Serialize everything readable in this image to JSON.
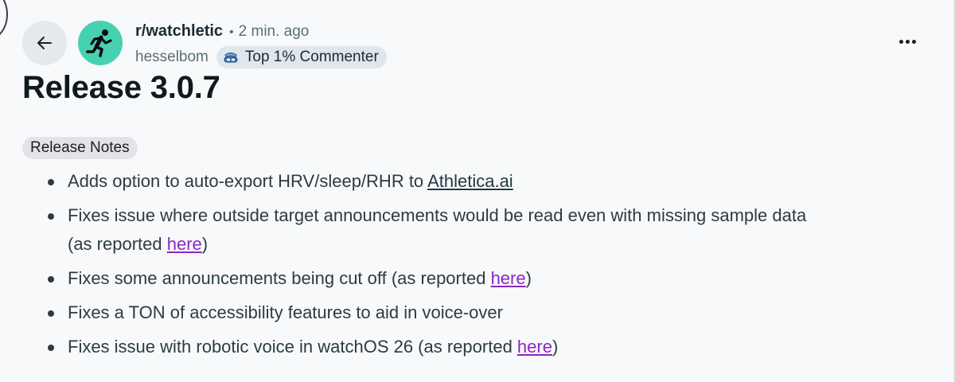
{
  "post": {
    "community": "r/watchletic",
    "separator": "•",
    "time_ago": "2 min. ago",
    "author": "hesselbom",
    "author_flair": "Top 1% Commenter",
    "title": "Release 3.0.7",
    "post_flair": "Release Notes",
    "notes": [
      {
        "text": "Adds option to auto-export HRV/sleep/RHR to ",
        "link": "Athletica.ai",
        "after": ""
      },
      {
        "text": "Fixes issue where outside target announcements would be read even with missing sample data",
        "line2_before": "(as reported ",
        "link": "here",
        "after": ")"
      },
      {
        "text": "Fixes some announcements being cut off (as reported ",
        "link": "here",
        "after": ")"
      },
      {
        "text": "Fixes a TON of accessibility features to aid in voice-over"
      },
      {
        "text": "Fixes issue with robotic voice in watchOS 26 (as reported ",
        "link": "here",
        "after": ")"
      }
    ]
  },
  "icons": {
    "back": "arrow-left-icon",
    "avatar": "runner-icon",
    "flair": "commenter-badge-icon",
    "more": "ellipsis-icon"
  },
  "colors": {
    "background": "#f8f9fb",
    "avatar_bg": "#47d1b3",
    "visited_link": "#8a28c2",
    "flair_bg": "#dfe6ec"
  }
}
